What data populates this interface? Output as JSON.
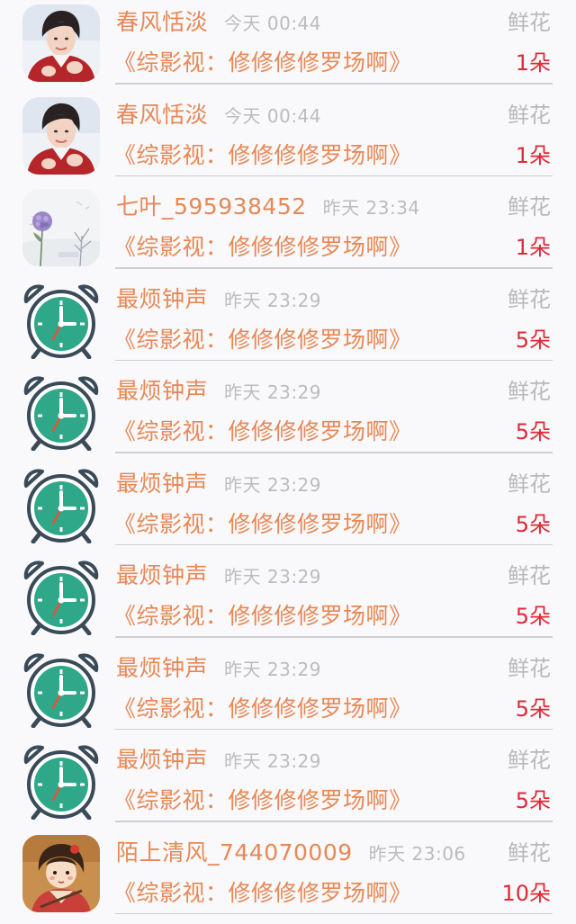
{
  "gifts": [
    {
      "avatar": "photo-portrait-red",
      "name": "春风恬淡",
      "time": "今天 00:44",
      "type": "鲜花",
      "book": "《综影视：修修修修罗场啊》",
      "count": "1朵"
    },
    {
      "avatar": "photo-portrait-red",
      "name": "春风恬淡",
      "time": "今天 00:44",
      "type": "鲜花",
      "book": "《综影视：修修修修罗场啊》",
      "count": "1朵"
    },
    {
      "avatar": "flower-winter-scene",
      "name": "七叶_595938452",
      "time": "昨天 23:34",
      "type": "鲜花",
      "book": "《综影视：修修修修罗场啊》",
      "count": "1朵"
    },
    {
      "avatar": "alarm-clock-icon",
      "name": "最烦钟声",
      "time": "昨天 23:29",
      "type": "鲜花",
      "book": "《综影视：修修修修罗场啊》",
      "count": "5朵"
    },
    {
      "avatar": "alarm-clock-icon",
      "name": "最烦钟声",
      "time": "昨天 23:29",
      "type": "鲜花",
      "book": "《综影视：修修修修罗场啊》",
      "count": "5朵"
    },
    {
      "avatar": "alarm-clock-icon",
      "name": "最烦钟声",
      "time": "昨天 23:29",
      "type": "鲜花",
      "book": "《综影视：修修修修罗场啊》",
      "count": "5朵"
    },
    {
      "avatar": "alarm-clock-icon",
      "name": "最烦钟声",
      "time": "昨天 23:29",
      "type": "鲜花",
      "book": "《综影视：修修修修罗场啊》",
      "count": "5朵"
    },
    {
      "avatar": "alarm-clock-icon",
      "name": "最烦钟声",
      "time": "昨天 23:29",
      "type": "鲜花",
      "book": "《综影视：修修修修罗场啊》",
      "count": "5朵"
    },
    {
      "avatar": "alarm-clock-icon",
      "name": "最烦钟声",
      "time": "昨天 23:29",
      "type": "鲜花",
      "book": "《综影视：修修修修罗场啊》",
      "count": "5朵"
    },
    {
      "avatar": "illustrated-girl",
      "name": "陌上清风_744070009",
      "time": "昨天 23:06",
      "type": "鲜花",
      "book": "《综影视：修修修修罗场啊》",
      "count": "10朵"
    }
  ],
  "colors": {
    "name": "#e78855",
    "meta": "#bcbcbf",
    "count": "#de2a38",
    "divider": "#cfcfd3",
    "clock_face": "#2fa889"
  }
}
